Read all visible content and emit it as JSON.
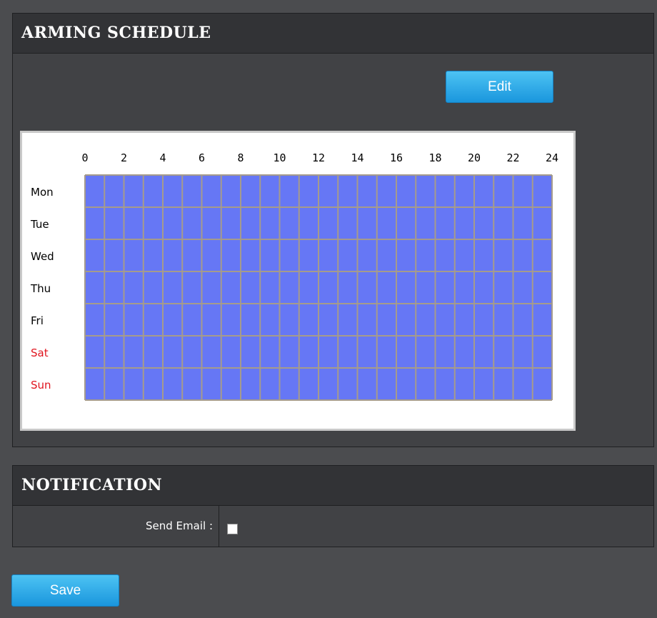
{
  "arming_schedule": {
    "title": "ARMING SCHEDULE",
    "edit_label": "Edit",
    "hour_labels": [
      "0",
      "2",
      "4",
      "6",
      "8",
      "10",
      "12",
      "14",
      "16",
      "18",
      "20",
      "22",
      "24"
    ],
    "days": [
      {
        "label": "Mon",
        "weekend": false
      },
      {
        "label": "Tue",
        "weekend": false
      },
      {
        "label": "Wed",
        "weekend": false
      },
      {
        "label": "Thu",
        "weekend": false
      },
      {
        "label": "Fri",
        "weekend": false
      },
      {
        "label": "Sat",
        "weekend": true
      },
      {
        "label": "Sun",
        "weekend": true
      }
    ],
    "armed_slots": "all hours armed every day",
    "colors": {
      "armed_fill": "#6677f5",
      "grid_line": "#a59b8c",
      "weekday_text": "#000000",
      "weekend_text": "#e0141e"
    }
  },
  "notification": {
    "title": "NOTIFICATION",
    "send_email_label": "Send Email :",
    "send_email_checked": false
  },
  "save_label": "Save"
}
